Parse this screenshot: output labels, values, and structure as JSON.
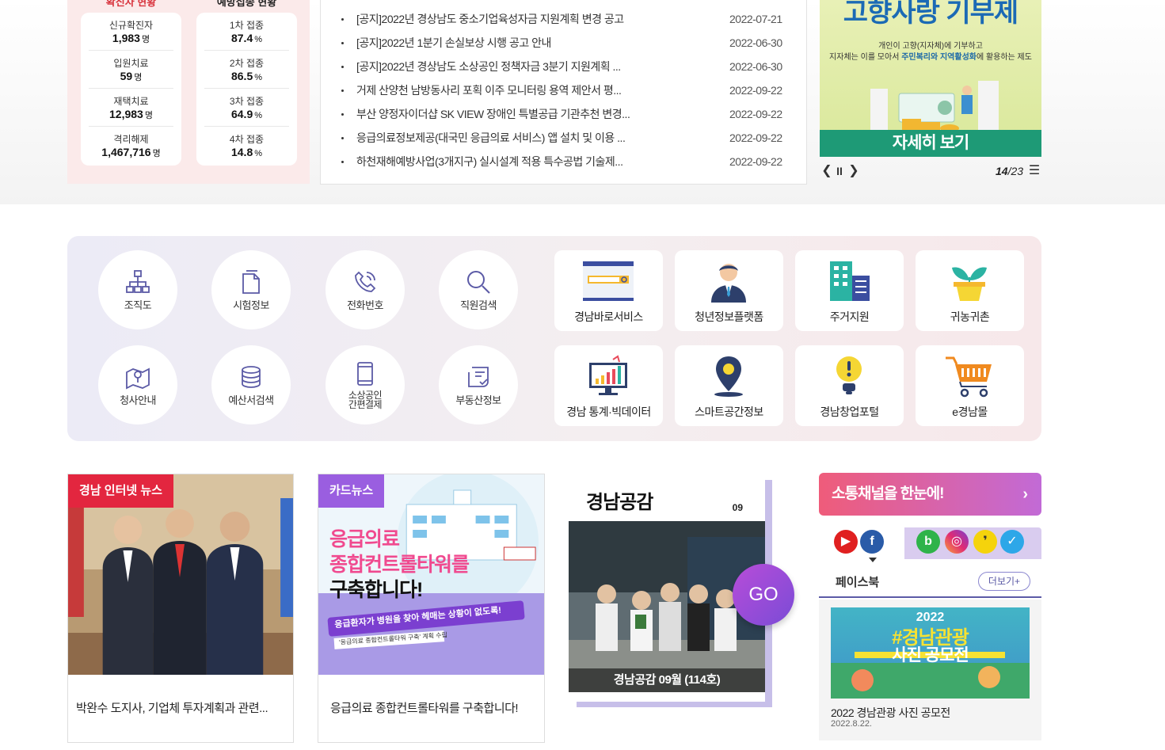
{
  "covid": {
    "confirmed": {
      "title": "확진자 현황",
      "stats": [
        {
          "label": "신규확진자",
          "value": "1,983",
          "unit": "명"
        },
        {
          "label": "입원치료",
          "value": "59",
          "unit": "명"
        },
        {
          "label": "재택치료",
          "value": "12,983",
          "unit": "명"
        },
        {
          "label": "격리해제",
          "value": "1,467,716",
          "unit": "명"
        }
      ]
    },
    "vaccine": {
      "title": "예방접종 현황",
      "stats": [
        {
          "label": "1차 접종",
          "value": "87.4",
          "unit": "%"
        },
        {
          "label": "2차 접종",
          "value": "86.5",
          "unit": "%"
        },
        {
          "label": "3차 접종",
          "value": "64.9",
          "unit": "%"
        },
        {
          "label": "4차 접종",
          "value": "14.8",
          "unit": "%"
        }
      ]
    }
  },
  "notices": [
    {
      "title": "[공지]2022년 경상남도 중소기업육성자금 지원계획 변경 공고",
      "date": "2022-07-21"
    },
    {
      "title": "[공지]2022년 1분기 손실보상 시행 공고 안내",
      "date": "2022-06-30"
    },
    {
      "title": "[공지]2022년 경상남도 소상공인 정책자금 3분기 지원계획 ...",
      "date": "2022-06-30"
    },
    {
      "title": "거제 산양천 남방동사리 포획 이주 모니터링 용역 제안서 평...",
      "date": "2022-09-22"
    },
    {
      "title": "부산 양정자이더샵 SK VIEW 장애인 특별공급 기관추천 변경...",
      "date": "2022-09-22"
    },
    {
      "title": "응급의료정보제공(대국민 응급의료 서비스) 앱 설치 및 이용 ...",
      "date": "2022-09-22"
    },
    {
      "title": "하천재해예방사업(3개지구) 실시설계 적용 특수공법 기술제...",
      "date": "2022-09-22"
    }
  ],
  "banner": {
    "headline": "고향사랑 기부제",
    "sub1": "개인이 고향(지자체)에 기부하고",
    "sub2_a": "지자체는 이를 모아서 ",
    "sub2_b": "주민복리와 지역활성화",
    "sub2_c": "에 활용하는 제도",
    "button": "자세히 보기",
    "prev": "❮",
    "pause": "II",
    "next": "❯",
    "page_current": "14",
    "page_sep": "/",
    "page_total": "23",
    "list": "☰"
  },
  "quick_circles": [
    {
      "label": "조직도",
      "icon": "org-chart-icon"
    },
    {
      "label": "시험정보",
      "icon": "document-icon"
    },
    {
      "label": "전화번호",
      "icon": "phone-icon"
    },
    {
      "label": "직원검색",
      "icon": "search-icon"
    },
    {
      "label": "청사안내",
      "icon": "map-pin-icon"
    },
    {
      "label": "예산서검색",
      "icon": "database-icon"
    },
    {
      "label": "소상공인\n간편결제",
      "label1": "소상공인",
      "label2": "간편결제",
      "icon": "mobile-icon"
    },
    {
      "label": "부동산정보",
      "icon": "certificate-icon"
    }
  ],
  "quick_boxes": [
    {
      "label": "경남바로서비스",
      "icon": "web-search-icon"
    },
    {
      "label": "청년정보플랫폼",
      "icon": "person-icon"
    },
    {
      "label": "주거지원",
      "icon": "building-icon"
    },
    {
      "label": "귀농귀촌",
      "icon": "sprout-icon"
    },
    {
      "label": "경남 통계·빅데이터",
      "icon": "chart-monitor-icon"
    },
    {
      "label": "스마트공간정보",
      "icon": "location-icon"
    },
    {
      "label": "경남창업포털",
      "icon": "bulb-icon"
    },
    {
      "label": "e경남몰",
      "icon": "cart-icon"
    }
  ],
  "news_internet": {
    "tag": "경남 인터넷 뉴스",
    "caption": "박완수 도지사, 기업체 투자계획과 관련..."
  },
  "news_card": {
    "tag": "카드뉴스",
    "line1": "응급의료",
    "line2": "종합컨트롤타워를",
    "line3": "구축합니다!",
    "ribbon": "응급환자가 병원을 찾아 헤매는 상황이 없도록!",
    "small": "'응급의료 종합컨트롤타워 구축' 계획 수립",
    "caption": "응급의료 종합컨트롤타워를 구축합니다!"
  },
  "magazine": {
    "title": "경남공감",
    "issue_no": "09",
    "caption": "경남공감 09월 (114호)",
    "go": "GO"
  },
  "social": {
    "header": "소통채널을 한눈에!",
    "arrow": "›",
    "facebook_title": "페이스북",
    "more": "더보기+",
    "img_year": "2022",
    "img_title": "#경남관광",
    "img_sub": "사진 공모전",
    "post_title": "2022 경남관광 사진 공모전",
    "post_date": "2022.8.22."
  },
  "colors": {
    "accent_red": "#d8323c",
    "tag_red": "#e3263f",
    "tag_purple": "#9a5ee0",
    "facebook_line": "#5b5aa6",
    "banner_green": "#1e9a76"
  }
}
